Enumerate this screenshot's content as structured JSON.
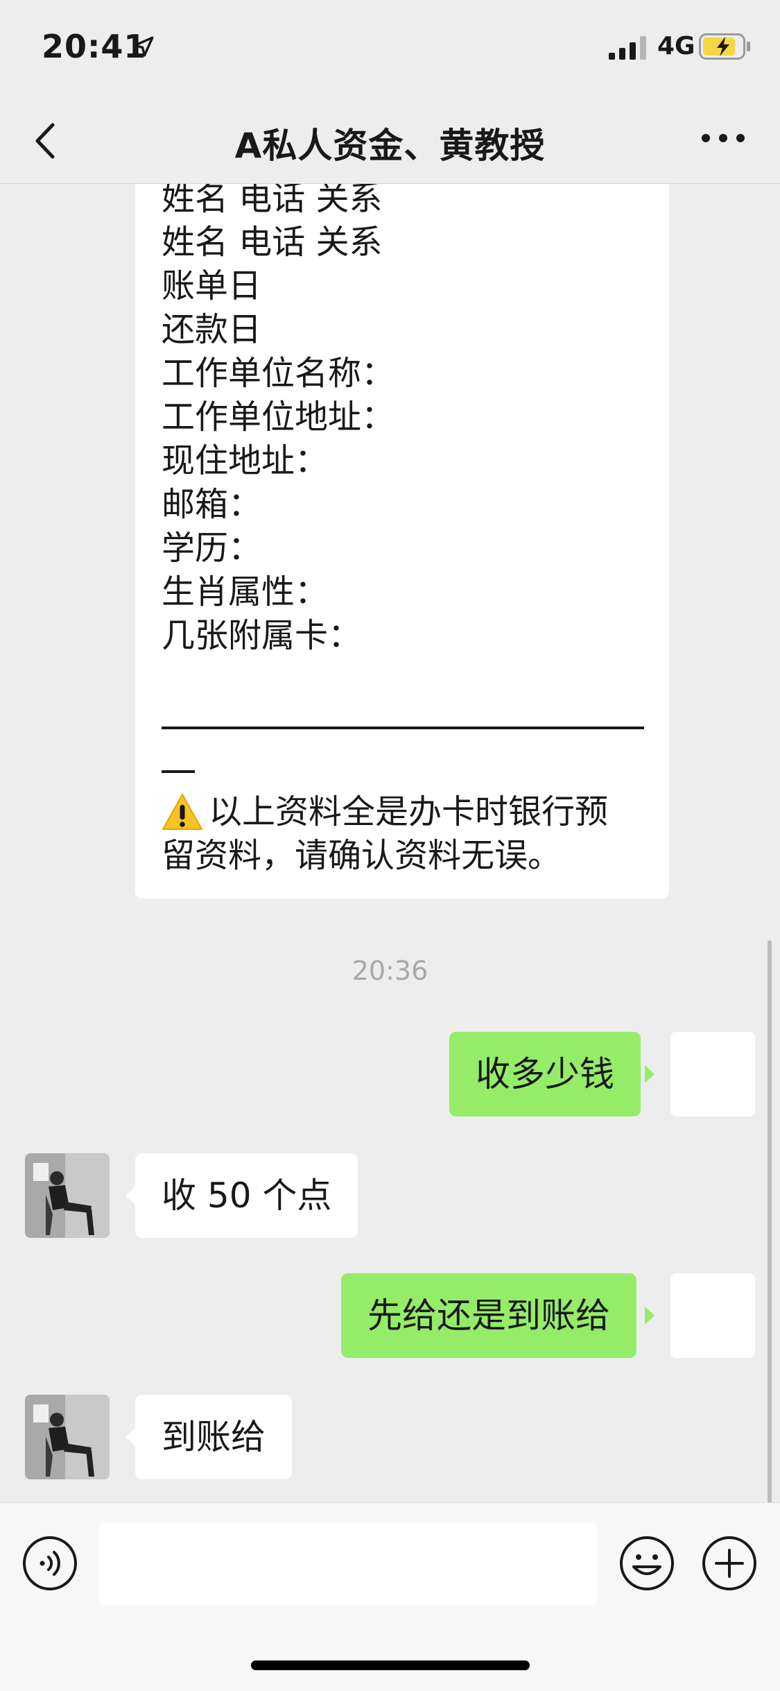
{
  "status_bar": {
    "time": "20:41",
    "network": "4G",
    "icons": [
      "location-arrow-icon",
      "signal-icon",
      "battery-charging-icon"
    ]
  },
  "nav": {
    "title": "A私人资金、黄教授",
    "icons": [
      "back-chevron-icon",
      "more-dots-icon"
    ]
  },
  "info_message": {
    "lines": [
      "姓名 电话 关系",
      "姓名 电话 关系",
      "账单日",
      "还款日",
      "工作单位名称：",
      "工作单位地址：",
      "现住地址：",
      "邮箱：",
      "学历：",
      "生肖属性：",
      "几张附属卡："
    ],
    "notice_line1": "以上资料全是办卡时银行预",
    "notice_line2": "留资料，请确认资料无误。",
    "notice_icon": "warning-icon"
  },
  "timestamp": "20:36",
  "messages": [
    {
      "side": "right",
      "text": "收多少钱"
    },
    {
      "side": "left",
      "text": "收 50 个点"
    },
    {
      "side": "right",
      "text": "先给还是到账给"
    },
    {
      "side": "left",
      "text": "到账给"
    }
  ],
  "input_bar": {
    "value": "",
    "icons": [
      "voice-icon",
      "emoji-icon",
      "plus-icon"
    ]
  },
  "colors": {
    "background": "#ededed",
    "sent_bubble": "#95ec69",
    "received_bubble": "#ffffff",
    "battery": "#f5d742"
  }
}
